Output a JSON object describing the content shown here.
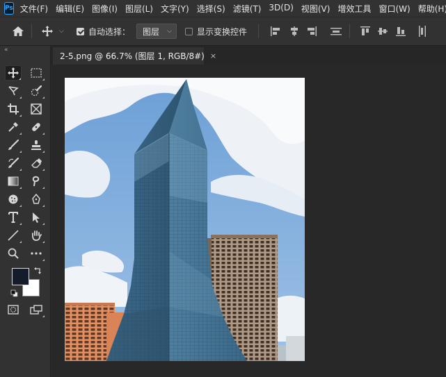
{
  "app": {
    "logo": "Ps"
  },
  "menu": [
    "文件(F)",
    "编辑(E)",
    "图像(I)",
    "图层(L)",
    "文字(Y)",
    "选择(S)",
    "滤镜(T)",
    "3D(D)",
    "视图(V)",
    "增效工具",
    "窗口(W)",
    "帮助(H)"
  ],
  "options": {
    "auto_select_label": "自动选择：",
    "auto_select_checked": true,
    "layer_target": "图层",
    "show_transform_label": "显示变换控件",
    "show_transform_checked": false
  },
  "document": {
    "tab_title": "2-5.png @ 66.7% (图层 1, RGB/8#)",
    "close_glyph": "×"
  },
  "tools": [
    {
      "name": "move-tool",
      "icon": "move-icon"
    },
    {
      "name": "marquee-tool",
      "icon": "rect-marquee-icon"
    },
    {
      "name": "lasso-tool",
      "icon": "lasso-icon"
    },
    {
      "name": "quick-select-tool",
      "icon": "quick-select-icon"
    },
    {
      "name": "crop-tool",
      "icon": "crop-icon"
    },
    {
      "name": "frame-tool",
      "icon": "frame-icon"
    },
    {
      "name": "eyedropper-tool",
      "icon": "eyedropper-icon"
    },
    {
      "name": "healing-tool",
      "icon": "bandage-icon"
    },
    {
      "name": "brush-tool",
      "icon": "brush-icon"
    },
    {
      "name": "stamp-tool",
      "icon": "stamp-icon"
    },
    {
      "name": "history-brush-tool",
      "icon": "history-brush-icon"
    },
    {
      "name": "eraser-tool",
      "icon": "eraser-icon"
    },
    {
      "name": "gradient-tool",
      "icon": "gradient-icon"
    },
    {
      "name": "smudge-tool",
      "icon": "smudge-icon"
    },
    {
      "name": "dodge-tool",
      "icon": "sponge-icon"
    },
    {
      "name": "pen-tool",
      "icon": "pen-icon"
    },
    {
      "name": "type-tool",
      "icon": "type-icon"
    },
    {
      "name": "path-select-tool",
      "icon": "arrow-icon"
    },
    {
      "name": "shape-tool",
      "icon": "line-icon"
    },
    {
      "name": "hand-tool",
      "icon": "hand-icon"
    },
    {
      "name": "zoom-tool",
      "icon": "zoom-icon"
    },
    {
      "name": "more-tools",
      "icon": "more-icon"
    }
  ],
  "colors": {
    "foreground": "#141c2c",
    "background": "#ffffff",
    "ui_bg": "#323232",
    "workspace": "#262626"
  }
}
